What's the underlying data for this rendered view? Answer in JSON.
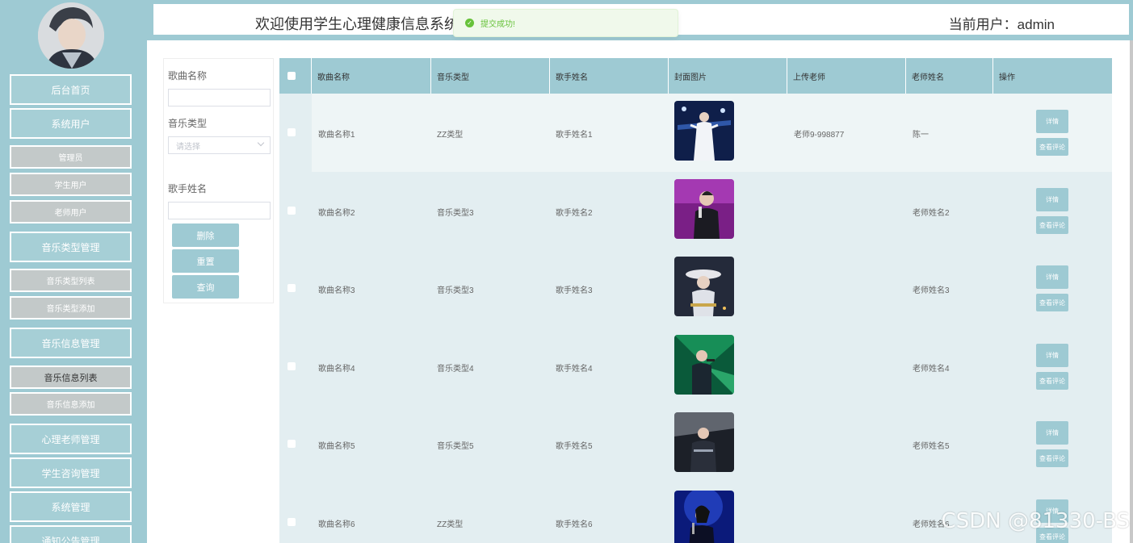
{
  "header": {
    "title": "欢迎使用学生心理健康信息系统",
    "current_user": "当前用户：admin"
  },
  "toast": {
    "message": "提交成功!",
    "color": "#67c23a"
  },
  "sidebar": {
    "accent_color": "#9ecad3",
    "items": [
      {
        "label": "后台首页",
        "kind": "menu"
      },
      {
        "label": "系统用户",
        "kind": "menu"
      },
      {
        "label": "管理员",
        "kind": "sub"
      },
      {
        "label": "学生用户",
        "kind": "sub"
      },
      {
        "label": "老师用户",
        "kind": "sub"
      },
      {
        "label": "音乐类型管理",
        "kind": "menu"
      },
      {
        "label": "音乐类型列表",
        "kind": "sub"
      },
      {
        "label": "音乐类型添加",
        "kind": "sub"
      },
      {
        "label": "音乐信息管理",
        "kind": "menu"
      },
      {
        "label": "音乐信息列表",
        "kind": "sub",
        "active": true
      },
      {
        "label": "音乐信息添加",
        "kind": "sub"
      },
      {
        "label": "心理老师管理",
        "kind": "menu"
      },
      {
        "label": "学生咨询管理",
        "kind": "menu"
      },
      {
        "label": "系统管理",
        "kind": "menu"
      },
      {
        "label": "通知公告管理",
        "kind": "menu"
      }
    ]
  },
  "search": {
    "song_name_label": "歌曲名称",
    "song_name_value": "",
    "music_type_label": "音乐类型",
    "music_type_placeholder": "请选择",
    "singer_label": "歌手姓名",
    "singer_value": "",
    "delete_label": "删除",
    "reset_label": "重置",
    "query_label": "查询"
  },
  "table": {
    "columns": [
      "歌曲名称",
      "音乐类型",
      "歌手姓名",
      "封面图片",
      "上传老师",
      "老师姓名",
      "操作"
    ],
    "detail_label": "详情",
    "comments_label": "查看评论",
    "rows": [
      {
        "song": "歌曲名称1",
        "type": "ZZ类型",
        "singer": "歌手姓名1",
        "uploader": "老师9-998877",
        "teacher": "陈一",
        "cover": "cover-stage-white-dress"
      },
      {
        "song": "歌曲名称2",
        "type": "音乐类型3",
        "singer": "歌手姓名2",
        "uploader": "",
        "teacher": "老师姓名2",
        "cover": "cover-purple-stage"
      },
      {
        "song": "歌曲名称3",
        "type": "音乐类型3",
        "singer": "歌手姓名3",
        "uploader": "",
        "teacher": "老师姓名3",
        "cover": "cover-singer-hat"
      },
      {
        "song": "歌曲名称4",
        "type": "音乐类型4",
        "singer": "歌手姓名4",
        "uploader": "",
        "teacher": "老师姓名4",
        "cover": "cover-green-stage"
      },
      {
        "song": "歌曲名称5",
        "type": "音乐类型5",
        "singer": "歌手姓名5",
        "uploader": "",
        "teacher": "老师姓名5",
        "cover": "cover-dark-stage"
      },
      {
        "song": "歌曲名称6",
        "type": "ZZ类型",
        "singer": "歌手姓名6",
        "uploader": "",
        "teacher": "老师姓名6",
        "cover": "cover-blue-stage"
      }
    ]
  },
  "watermark": "CSDN @81330-BS"
}
